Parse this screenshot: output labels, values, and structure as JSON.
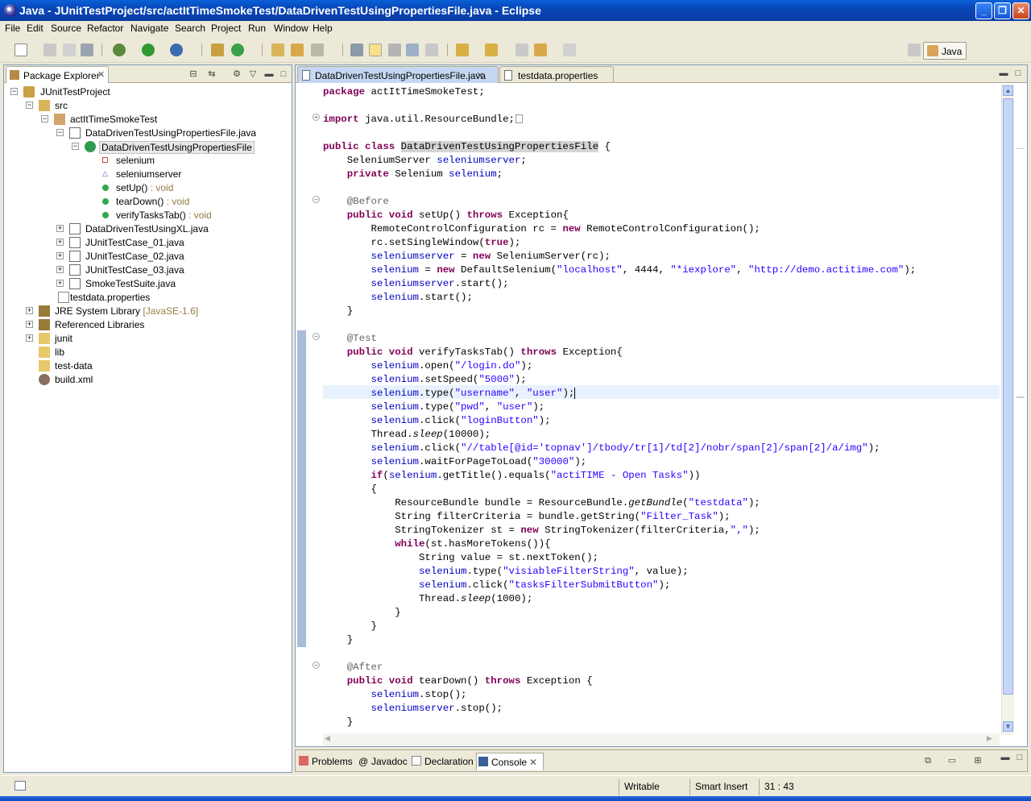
{
  "window": {
    "title": "Java - JUnitTestProject/src/actItTimeSmokeTest/DataDrivenTestUsingPropertiesFile.java - Eclipse"
  },
  "menu": [
    "File",
    "Edit",
    "Source",
    "Refactor",
    "Navigate",
    "Search",
    "Project",
    "Run",
    "Window",
    "Help"
  ],
  "perspective": {
    "label": "Java"
  },
  "package_explorer": {
    "title": "Package Explorer",
    "tree": [
      {
        "label": "JUnitTestProject",
        "decoration": ""
      },
      {
        "label": "src",
        "decoration": ""
      },
      {
        "label": "actItTimeSmokeTest",
        "decoration": ""
      },
      {
        "label": "DataDrivenTestUsingPropertiesFile.java",
        "decoration": ""
      },
      {
        "label": "DataDrivenTestUsingPropertiesFile",
        "decoration": ""
      },
      {
        "label": "selenium",
        "decoration": ""
      },
      {
        "label": "seleniumserver",
        "decoration": ""
      },
      {
        "label": "setUp()",
        "decoration": ": void"
      },
      {
        "label": "tearDown()",
        "decoration": ": void"
      },
      {
        "label": "verifyTasksTab()",
        "decoration": ": void"
      },
      {
        "label": "DataDrivenTestUsingXL.java",
        "decoration": ""
      },
      {
        "label": "JUnitTestCase_01.java",
        "decoration": ""
      },
      {
        "label": "JUnitTestCase_02.java",
        "decoration": ""
      },
      {
        "label": "JUnitTestCase_03.java",
        "decoration": ""
      },
      {
        "label": "SmokeTestSuite.java",
        "decoration": ""
      },
      {
        "label": "testdata.properties",
        "decoration": ""
      },
      {
        "label": "JRE System Library",
        "decoration": "[JavaSE-1.6]"
      },
      {
        "label": "Referenced Libraries",
        "decoration": ""
      },
      {
        "label": "junit",
        "decoration": ""
      },
      {
        "label": "lib",
        "decoration": ""
      },
      {
        "label": "test-data",
        "decoration": ""
      },
      {
        "label": "build.xml",
        "decoration": ""
      }
    ]
  },
  "editor": {
    "tabs": [
      "DataDrivenTestUsingPropertiesFile.java",
      "testdata.properties"
    ],
    "code": [
      "package actItTimeSmokeTest;",
      "",
      "import java.util.ResourceBundle;",
      "",
      "public class DataDrivenTestUsingPropertiesFile {",
      "    SeleniumServer seleniumserver;",
      "    private Selenium selenium;",
      "",
      "    @Before",
      "    public void setUp() throws Exception{",
      "        RemoteControlConfiguration rc = new RemoteControlConfiguration();",
      "        rc.setSingleWindow(true);",
      "        seleniumserver = new SeleniumServer(rc);",
      "        selenium = new DefaultSelenium(\"localhost\", 4444, \"*iexplore\", \"http://demo.actitime.com\");",
      "        seleniumserver.start();",
      "        selenium.start();",
      "    }",
      "",
      "    @Test",
      "    public void verifyTasksTab() throws Exception{",
      "        selenium.open(\"/login.do\");",
      "        selenium.setSpeed(\"5000\");",
      "        selenium.type(\"username\", \"user\");",
      "        selenium.type(\"pwd\", \"user\");",
      "        selenium.click(\"loginButton\");",
      "        Thread.sleep(10000);",
      "        selenium.click(\"//table[@id='topnav']/tbody/tr[1]/td[2]/nobr/span[2]/span[2]/a/img\");",
      "        selenium.waitForPageToLoad(\"30000\");",
      "        if(selenium.getTitle().equals(\"actiTIME - Open Tasks\"))",
      "        {",
      "            ResourceBundle bundle = ResourceBundle.getBundle(\"testdata\");",
      "            String filterCriteria = bundle.getString(\"Filter_Task\");",
      "            StringTokenizer st = new StringTokenizer(filterCriteria,\",\");",
      "            while(st.hasMoreTokens()){",
      "                String value = st.nextToken();",
      "                selenium.type(\"visiableFilterString\", value);",
      "                selenium.click(\"tasksFilterSubmitButton\");",
      "                Thread.sleep(1000);",
      "            }",
      "        }",
      "    }",
      "",
      "    @After",
      "    public void tearDown() throws Exception {",
      "        selenium.stop();",
      "        seleniumserver.stop();",
      "    }"
    ]
  },
  "bottom_tabs": [
    "Problems",
    "Javadoc",
    "Declaration",
    "Console"
  ],
  "status": {
    "writable": "Writable",
    "insert_mode": "Smart Insert",
    "position": "31 : 43"
  }
}
